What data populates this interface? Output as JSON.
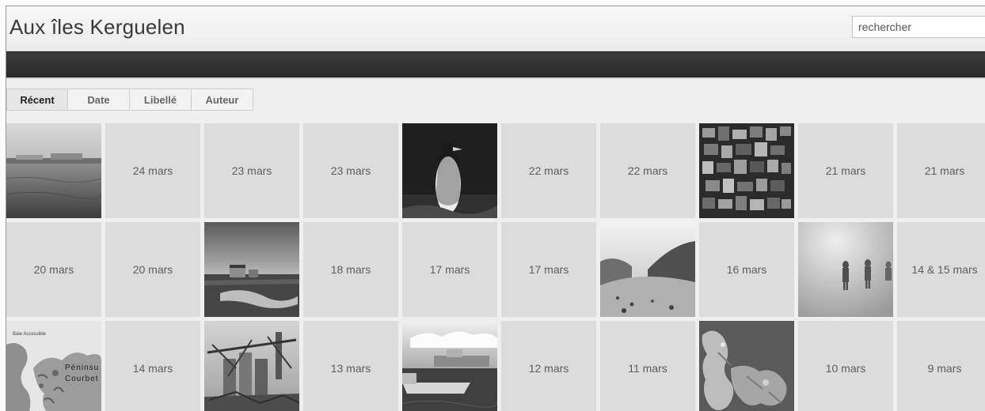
{
  "header": {
    "title": "Aux îles Kerguelen"
  },
  "search": {
    "placeholder": "rechercher"
  },
  "tabs": [
    {
      "label": "Récent",
      "active": true
    },
    {
      "label": "Date",
      "active": false
    },
    {
      "label": "Libellé",
      "active": false
    },
    {
      "label": "Auteur",
      "active": false
    }
  ],
  "grid": {
    "rows": [
      [
        {
          "type": "photo",
          "icon": "harbor-photo-icon"
        },
        {
          "type": "label",
          "label": "24 mars"
        },
        {
          "type": "label",
          "label": "23 mars"
        },
        {
          "type": "label",
          "label": "23 mars"
        },
        {
          "type": "photo",
          "icon": "penguin-photo-icon"
        },
        {
          "type": "label",
          "label": "22 mars"
        },
        {
          "type": "label",
          "label": "22 mars"
        },
        {
          "type": "photo",
          "icon": "photo-collage-icon"
        },
        {
          "type": "label",
          "label": "21 mars"
        },
        {
          "type": "label",
          "label": "21 mars"
        }
      ],
      [
        {
          "type": "label",
          "label": "20 mars"
        },
        {
          "type": "label",
          "label": "20 mars"
        },
        {
          "type": "photo",
          "icon": "hut-landscape-photo-icon"
        },
        {
          "type": "label",
          "label": "18 mars"
        },
        {
          "type": "label",
          "label": "17 mars"
        },
        {
          "type": "label",
          "label": "17 mars"
        },
        {
          "type": "photo",
          "icon": "valley-photo-icon"
        },
        {
          "type": "label",
          "label": "16 mars"
        },
        {
          "type": "photo",
          "icon": "fog-hikers-photo-icon"
        },
        {
          "type": "label",
          "label": "14 & 15 mars"
        }
      ],
      [
        {
          "type": "photo",
          "icon": "peninsula-map-icon",
          "map_text": [
            "Baie Accessible",
            "Péninsu",
            "Courbet"
          ]
        },
        {
          "type": "label",
          "label": "14 mars"
        },
        {
          "type": "photo",
          "icon": "ruined-factory-photo-icon"
        },
        {
          "type": "label",
          "label": "13 mars"
        },
        {
          "type": "photo",
          "icon": "boat-harbor-photo-icon"
        },
        {
          "type": "label",
          "label": "12 mars"
        },
        {
          "type": "label",
          "label": "11 mars"
        },
        {
          "type": "photo",
          "icon": "island-map-photo-icon"
        },
        {
          "type": "label",
          "label": "10 mars"
        },
        {
          "type": "label",
          "label": "9 mars"
        }
      ]
    ]
  }
}
